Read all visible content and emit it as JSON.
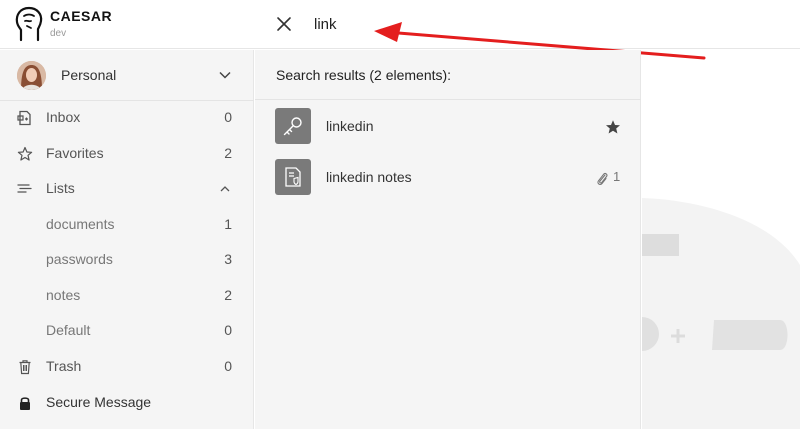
{
  "header": {
    "brand": "CAESAR",
    "brand_sub": "dev",
    "search_value": "link"
  },
  "sidebar": {
    "account": {
      "name": "Personal"
    },
    "items": [
      {
        "label": "Inbox",
        "count": "0",
        "icon": "inbox-icon"
      },
      {
        "label": "Favorites",
        "count": "2",
        "icon": "star-icon"
      },
      {
        "label": "Lists",
        "icon": "list-icon"
      },
      {
        "label": "documents",
        "count": "1"
      },
      {
        "label": "passwords",
        "count": "3"
      },
      {
        "label": "notes",
        "count": "2"
      },
      {
        "label": "Default",
        "count": "0"
      },
      {
        "label": "Trash",
        "count": "0",
        "icon": "trash-icon"
      },
      {
        "label": "Secure Message",
        "icon": "lock-icon"
      }
    ]
  },
  "results": {
    "title": "Search results (2 elements):",
    "items": [
      {
        "name": "linkedin",
        "icon": "key-icon",
        "favorite": true
      },
      {
        "name": "linkedin notes",
        "icon": "note-icon",
        "attachments": "1"
      }
    ]
  },
  "colors": {
    "sidebar_bg": "#f5f5f5",
    "tile_bg": "#7a7a7a",
    "annotation_arrow": "#e41e1e"
  }
}
